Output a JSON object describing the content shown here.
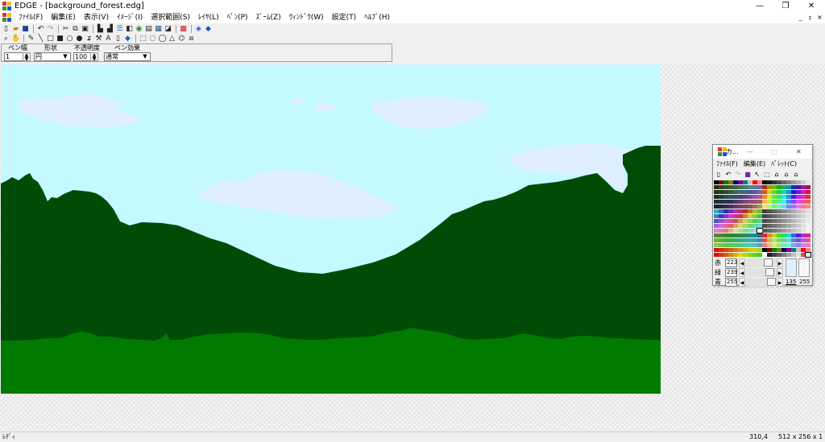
{
  "window": {
    "title": "EDGE - [background_forest.edg]",
    "controls": {
      "minimize": "—",
      "maximize": "❐",
      "close": "✕"
    },
    "mdi_controls": {
      "minimize": "_",
      "restore": "ｪ",
      "close": "×"
    }
  },
  "menubar": {
    "items": [
      "ﾌｧｲﾙ(F)",
      "編集(E)",
      "表示(V)",
      "ｲﾒｰｼﾞ(I)",
      "選択範囲(S)",
      "ﾚｲﾔ(L)",
      "ﾍﾟﾝ(P)",
      "ｽﾞｰﾑ(Z)",
      "ｳｨﾝﾄﾞｳ(W)",
      "設定(T)",
      "ﾍﾙﾌﾟ(H)"
    ]
  },
  "toolbar1": {
    "icons": [
      "new-file-icon",
      "open-folder-icon",
      "save-icon",
      "undo-icon",
      "redo-icon",
      "cut-icon",
      "copy-icon",
      "paste-icon",
      "layer-icon",
      "layer-merge-icon",
      "layer-list-icon",
      "image-flip-icon",
      "image-settings-icon",
      "frame-icon",
      "screen-icon",
      "preview-icon",
      "grid-icon",
      "animation-icon",
      "animation-play-icon"
    ]
  },
  "toolbar2": {
    "icons": [
      "zoom-icon",
      "hand-icon",
      "pen-icon",
      "line-icon",
      "rect-icon",
      "filled-rect-icon",
      "ellipse-icon",
      "filled-ellipse-icon",
      "spray-icon",
      "hammer-icon",
      "text-icon",
      "bucket-icon",
      "fill-icon",
      "rect-select-icon",
      "ellipse-select-icon",
      "lasso-select-icon",
      "polygon-select-icon",
      "magic-wand-icon",
      "select-add-icon"
    ]
  },
  "pen_panel": {
    "width_label": "ペン幅",
    "width_value": "1",
    "shape_label": "形状",
    "shape_value": "円",
    "opacity_label": "不透明度",
    "opacity_value": "100",
    "effect_label": "ペン効果",
    "effect_value": "通常"
  },
  "statusbar": {
    "mode": "ﾚﾃﾞｨ",
    "position": "310,4",
    "image_size": "512 x 256 x 1"
  },
  "color_window": {
    "title": "カ...",
    "menus": [
      "ﾌｧｲﾙ(F)",
      "編集(E)",
      "ﾊﾟﾚｯﾄ(C)"
    ],
    "tools": [
      "new-palette-icon",
      "undo-icon",
      "redo-icon",
      "palette-icon",
      "picker-icon",
      "select-icon",
      "tone-1-icon",
      "tone-2-icon",
      "tone-3-icon"
    ],
    "rgb": [
      {
        "label": "赤",
        "value": "223"
      },
      {
        "label": "緑",
        "value": "239"
      },
      {
        "label": "青",
        "value": "255"
      }
    ],
    "index_value": "135",
    "max_value": "255",
    "current_color": "#dfefff",
    "swatch_colors": [
      "#000000",
      "#800000",
      "#008000",
      "#808000",
      "#000080",
      "#800080",
      "#008080",
      "#c0c0c0",
      "#ff0000",
      "#ff8080",
      "#00ff00",
      "#80ff80",
      "#0000ff",
      "#8080ff",
      "#ffff00",
      "#ffffff",
      "#202020",
      "#404040",
      "#606060",
      "#808080",
      "#a0a0a0",
      "#c0c0c0",
      "#e0e0e0",
      "#ff4040",
      "#40ff40",
      "#4040ff",
      "#ffc000",
      "#ff00ff",
      "#00ffff",
      "#ff8000"
    ]
  },
  "canvas": {
    "sky_color": "#c4faff",
    "cloud_color": "#dfefff",
    "forest_color": "#004c07",
    "grass_color": "#007a00"
  }
}
